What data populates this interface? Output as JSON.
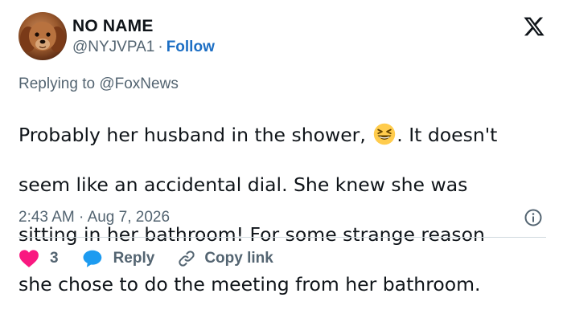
{
  "author": {
    "name": "NO NAME",
    "handle": "@NYJVPA1",
    "separator": "·",
    "follow_label": "Follow"
  },
  "reply_context": {
    "prefix": "Replying to",
    "mention": "@FoxNews"
  },
  "tweet": {
    "line1_a": "Probably her husband in the shower,",
    "line1_b": ".  It doesn't",
    "line2": "seem like an accidental dial.  She knew she was",
    "line3": "sitting in her bathroom!  For some strange reason",
    "line4": "she chose to do the meeting from her bathroom.",
    "emoji": "grinning-squinting-face"
  },
  "meta": {
    "time": "2:43 AM",
    "separator": "·",
    "date": "Aug 7, 2026"
  },
  "actions": {
    "like_count": "3",
    "reply_label": "Reply",
    "copy_label": "Copy link"
  },
  "icons": {
    "platform_logo": "x-logo-icon",
    "info": "info-icon",
    "like": "heart-icon",
    "reply": "speech-bubble-icon",
    "copy": "link-icon"
  },
  "colors": {
    "text": "#0f1419",
    "secondary": "#536471",
    "link": "#1d6fc4",
    "like": "#f91880",
    "reply": "#1d9bf0",
    "divider": "#cfd9de"
  }
}
